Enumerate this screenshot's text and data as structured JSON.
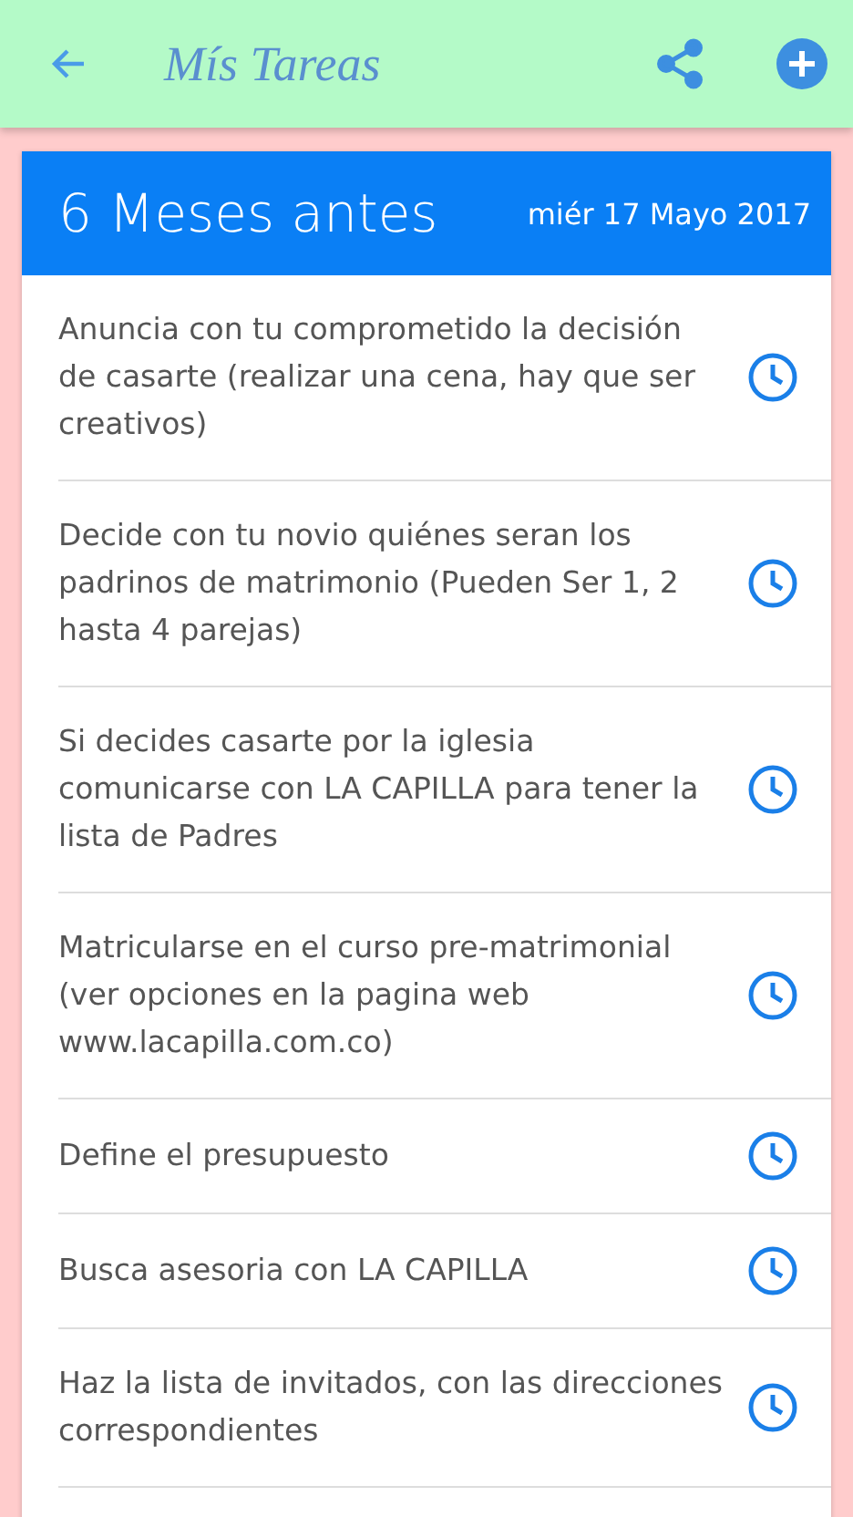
{
  "app_bar": {
    "title": "Mís Tareas"
  },
  "section": {
    "title": "6 Meses antes",
    "date": "miér 17 Mayo 2017"
  },
  "tasks": [
    {
      "text": "Anuncia con tu comprometido la decisión de casarte (realizar una cena, hay que ser creativos)"
    },
    {
      "text": "Decide con tu novio quiénes seran los padrinos de matrimonio (Pueden Ser 1, 2 hasta 4 parejas)"
    },
    {
      "text": "Si decides casarte por la iglesia comunicarse con LA CAPILLA para tener la lista de Padres"
    },
    {
      "text": "Matricularse en el curso pre-matrimonial (ver opciones en la pagina web www.lacapilla.com.co)"
    },
    {
      "text": "Define el presupuesto"
    },
    {
      "text": "Busca asesoria con LA CAPILLA"
    },
    {
      "text": "Haz la lista de invitados, con las direcciones correspondientes"
    }
  ]
}
